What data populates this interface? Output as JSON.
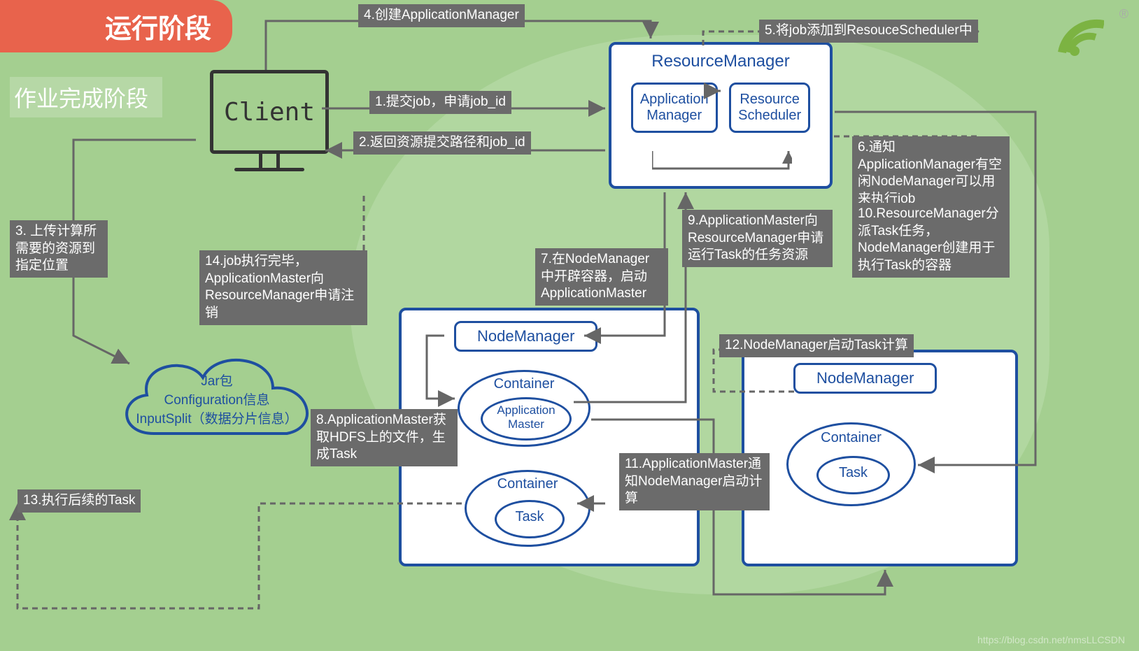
{
  "phase_run": "运行阶段",
  "phase_done": "作业完成阶段",
  "client": "Client",
  "rm": {
    "title": "ResourceManager",
    "appmgr": "Application\nManager",
    "scheduler": "Resource\nScheduler"
  },
  "nm1": {
    "title": "NodeManager",
    "c1": "Container",
    "c1_inner": "Application\nMaster",
    "c2": "Container",
    "c2_inner": "Task"
  },
  "nm2": {
    "title": "NodeManager",
    "c1": "Container",
    "c1_inner": "Task"
  },
  "cloud": {
    "l1": "Jar包",
    "l2": "Configuration信息",
    "l3": "InputSplit（数据分片信息）"
  },
  "steps": {
    "s1": "1.提交job，申请job_id",
    "s2": "2.返回资源提交路径和job_id",
    "s3": "3. 上传计算所需要的资源到指定位置",
    "s4": "4.创建ApplicationManager",
    "s5": "5.将job添加到ResouceScheduler中",
    "s6": "6.通知ApplicationManager有空闲NodeManager可以用来执行job",
    "s7": "7.在NodeManager中开辟容器，启动ApplicationMaster",
    "s8": "8.ApplicationMaster获取HDFS上的文件，生成Task",
    "s9": "9.ApplicationMaster向ResourceManager申请运行Task的任务资源",
    "s10": "10.ResourceManager分派Task任务，NodeManager创建用于执行Task的容器",
    "s11": "11.ApplicationMaster通知NodeManager启动计算",
    "s12": "12.NodeManager启动Task计算",
    "s13": "13.执行后续的Task",
    "s14": "14.job执行完毕，ApplicationMaster向ResourceManager申请注销"
  },
  "watermark": "https://blog.csdn.net/nmsLLCSDN",
  "reg": "®"
}
